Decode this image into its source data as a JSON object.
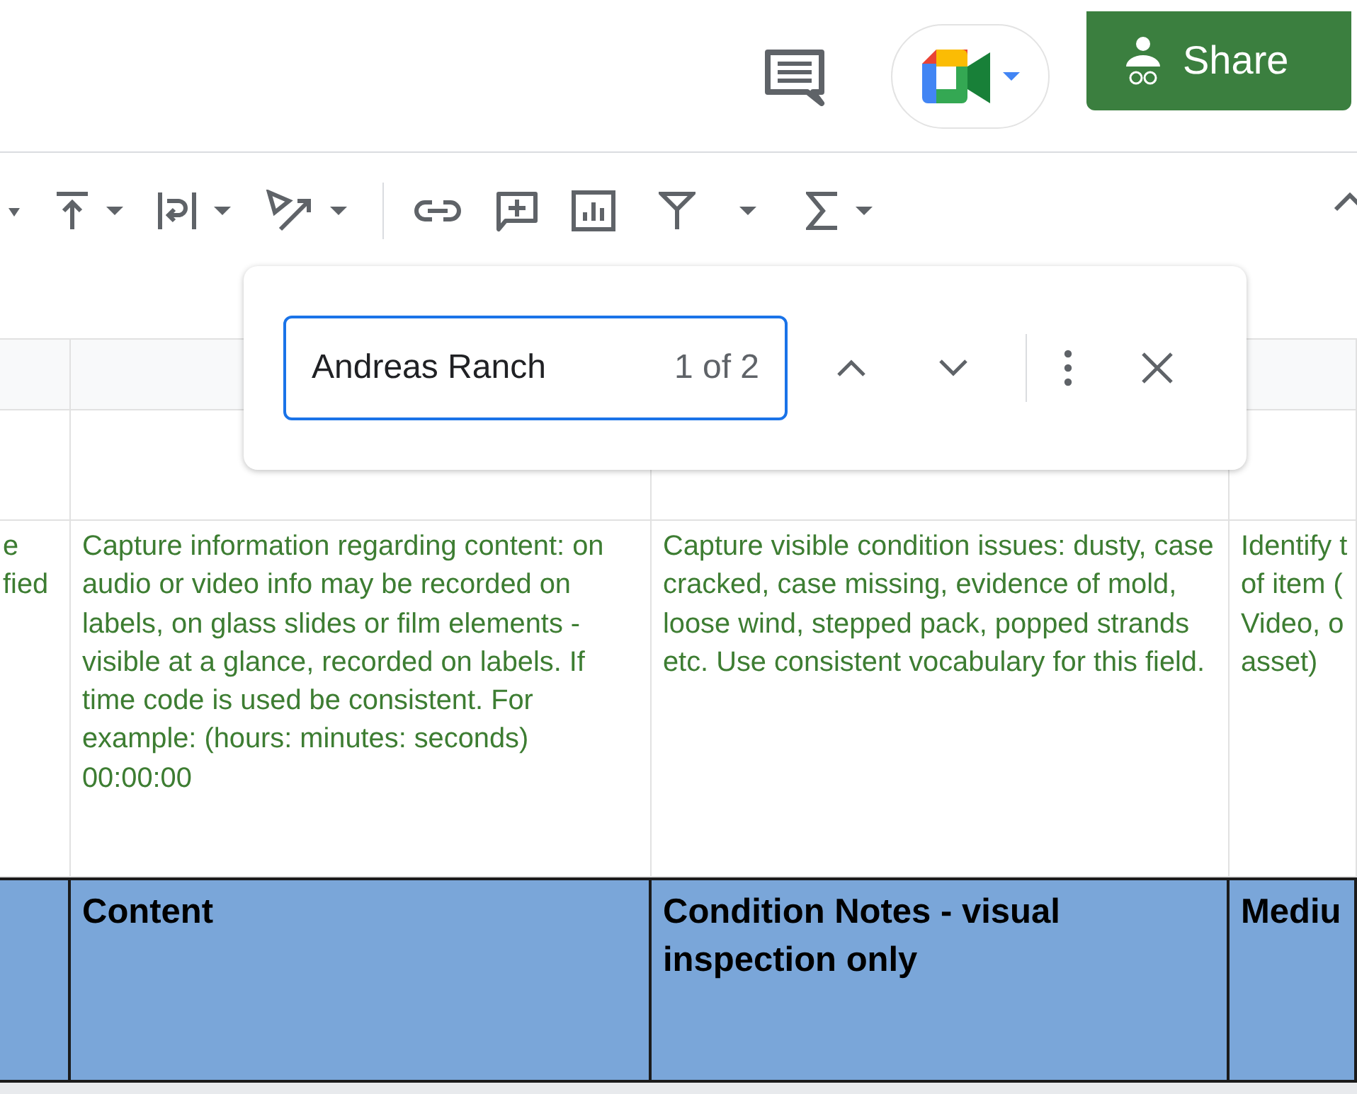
{
  "top_bar": {
    "share_button": {
      "label": "Share"
    }
  },
  "find_dialog": {
    "query": "Andreas Ranch",
    "match_count": "1 of 2"
  },
  "sheet": {
    "rows": [
      {
        "kind": "note",
        "column_1": "e\nfied",
        "column_2": "Capture information regarding content: on audio or video info may be recorded on labels, on glass slides or film elements - visible at a glance, recorded on labels. If time code is used be consistent. For example: (hours: minutes: seconds) 00:00:00",
        "column_3": "Capture visible condition issues: dusty, case cracked, case missing, evidence of mold, loose wind, stepped pack, popped strands etc. Use consistent vocabulary for this field.",
        "column_4": "Identify t\nof item (\nVideo, o\nasset)"
      },
      {
        "kind": "header",
        "column_2": "Content",
        "column_3": "Condition Notes - visual inspection only",
        "column_4": "Mediu"
      }
    ]
  }
}
